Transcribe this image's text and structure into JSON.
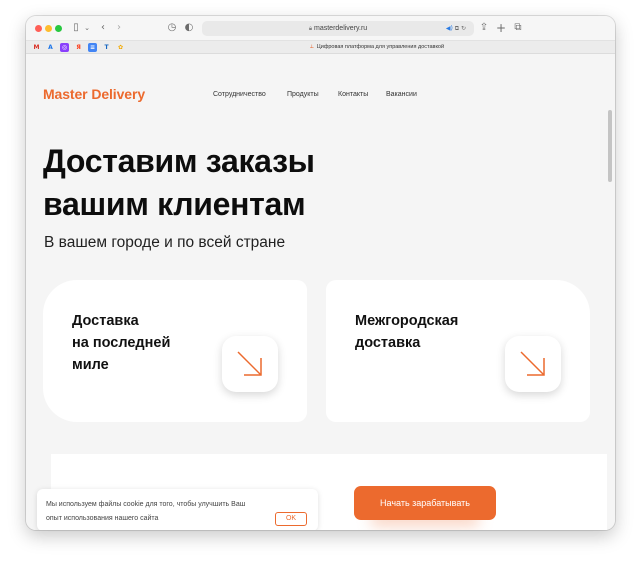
{
  "colors": {
    "accent": "#ec6a2e",
    "traffic_close": "#ff5f57",
    "traffic_min": "#febc2e",
    "traffic_max": "#28c840"
  },
  "browser": {
    "url": "masterdelivery.ru",
    "active_tab_title": "Цифровая платформа для управления доставкой",
    "toolbar_icons": [
      "sidebar-icon",
      "chevron-down-icon",
      "back-icon",
      "forward-icon",
      "history-icon",
      "privacy-shield-icon",
      "share-icon",
      "new-tab-icon",
      "tab-overview-icon"
    ],
    "favicons": [
      {
        "label": "M",
        "color": "#d93025"
      },
      {
        "label": "A",
        "color": "#1a73e8"
      },
      {
        "label": "◎",
        "color": "#8a3ffc"
      },
      {
        "label": "Я",
        "color": "#fc3f1d"
      },
      {
        "label": "≡",
        "color": "#4285f4"
      },
      {
        "label": "T",
        "color": "#1565c0"
      },
      {
        "label": "✿",
        "color": "#f2a900"
      }
    ]
  },
  "header": {
    "logo": "Master Delivery",
    "nav": [
      "Сотрудничество",
      "Продукты",
      "Контакты",
      "Вакансии"
    ]
  },
  "hero": {
    "title_line1": "Доставим заказы",
    "title_line2": "вашим клиентам",
    "subtitle": "В вашем городе и по всей стране"
  },
  "cards": [
    {
      "lines": [
        "Доставка",
        "на последней",
        "миле"
      ],
      "icon": "arrow-down-right-icon"
    },
    {
      "lines": [
        "Межгородская",
        "доставка"
      ],
      "icon": "arrow-down-right-icon"
    }
  ],
  "cookie": {
    "line1": "Мы используем файлы cookie для того, чтобы улучшить Ваш",
    "line2": "опыт использования нашего сайта",
    "ok": "OK"
  },
  "cta": {
    "label": "Начать зарабатывать"
  }
}
